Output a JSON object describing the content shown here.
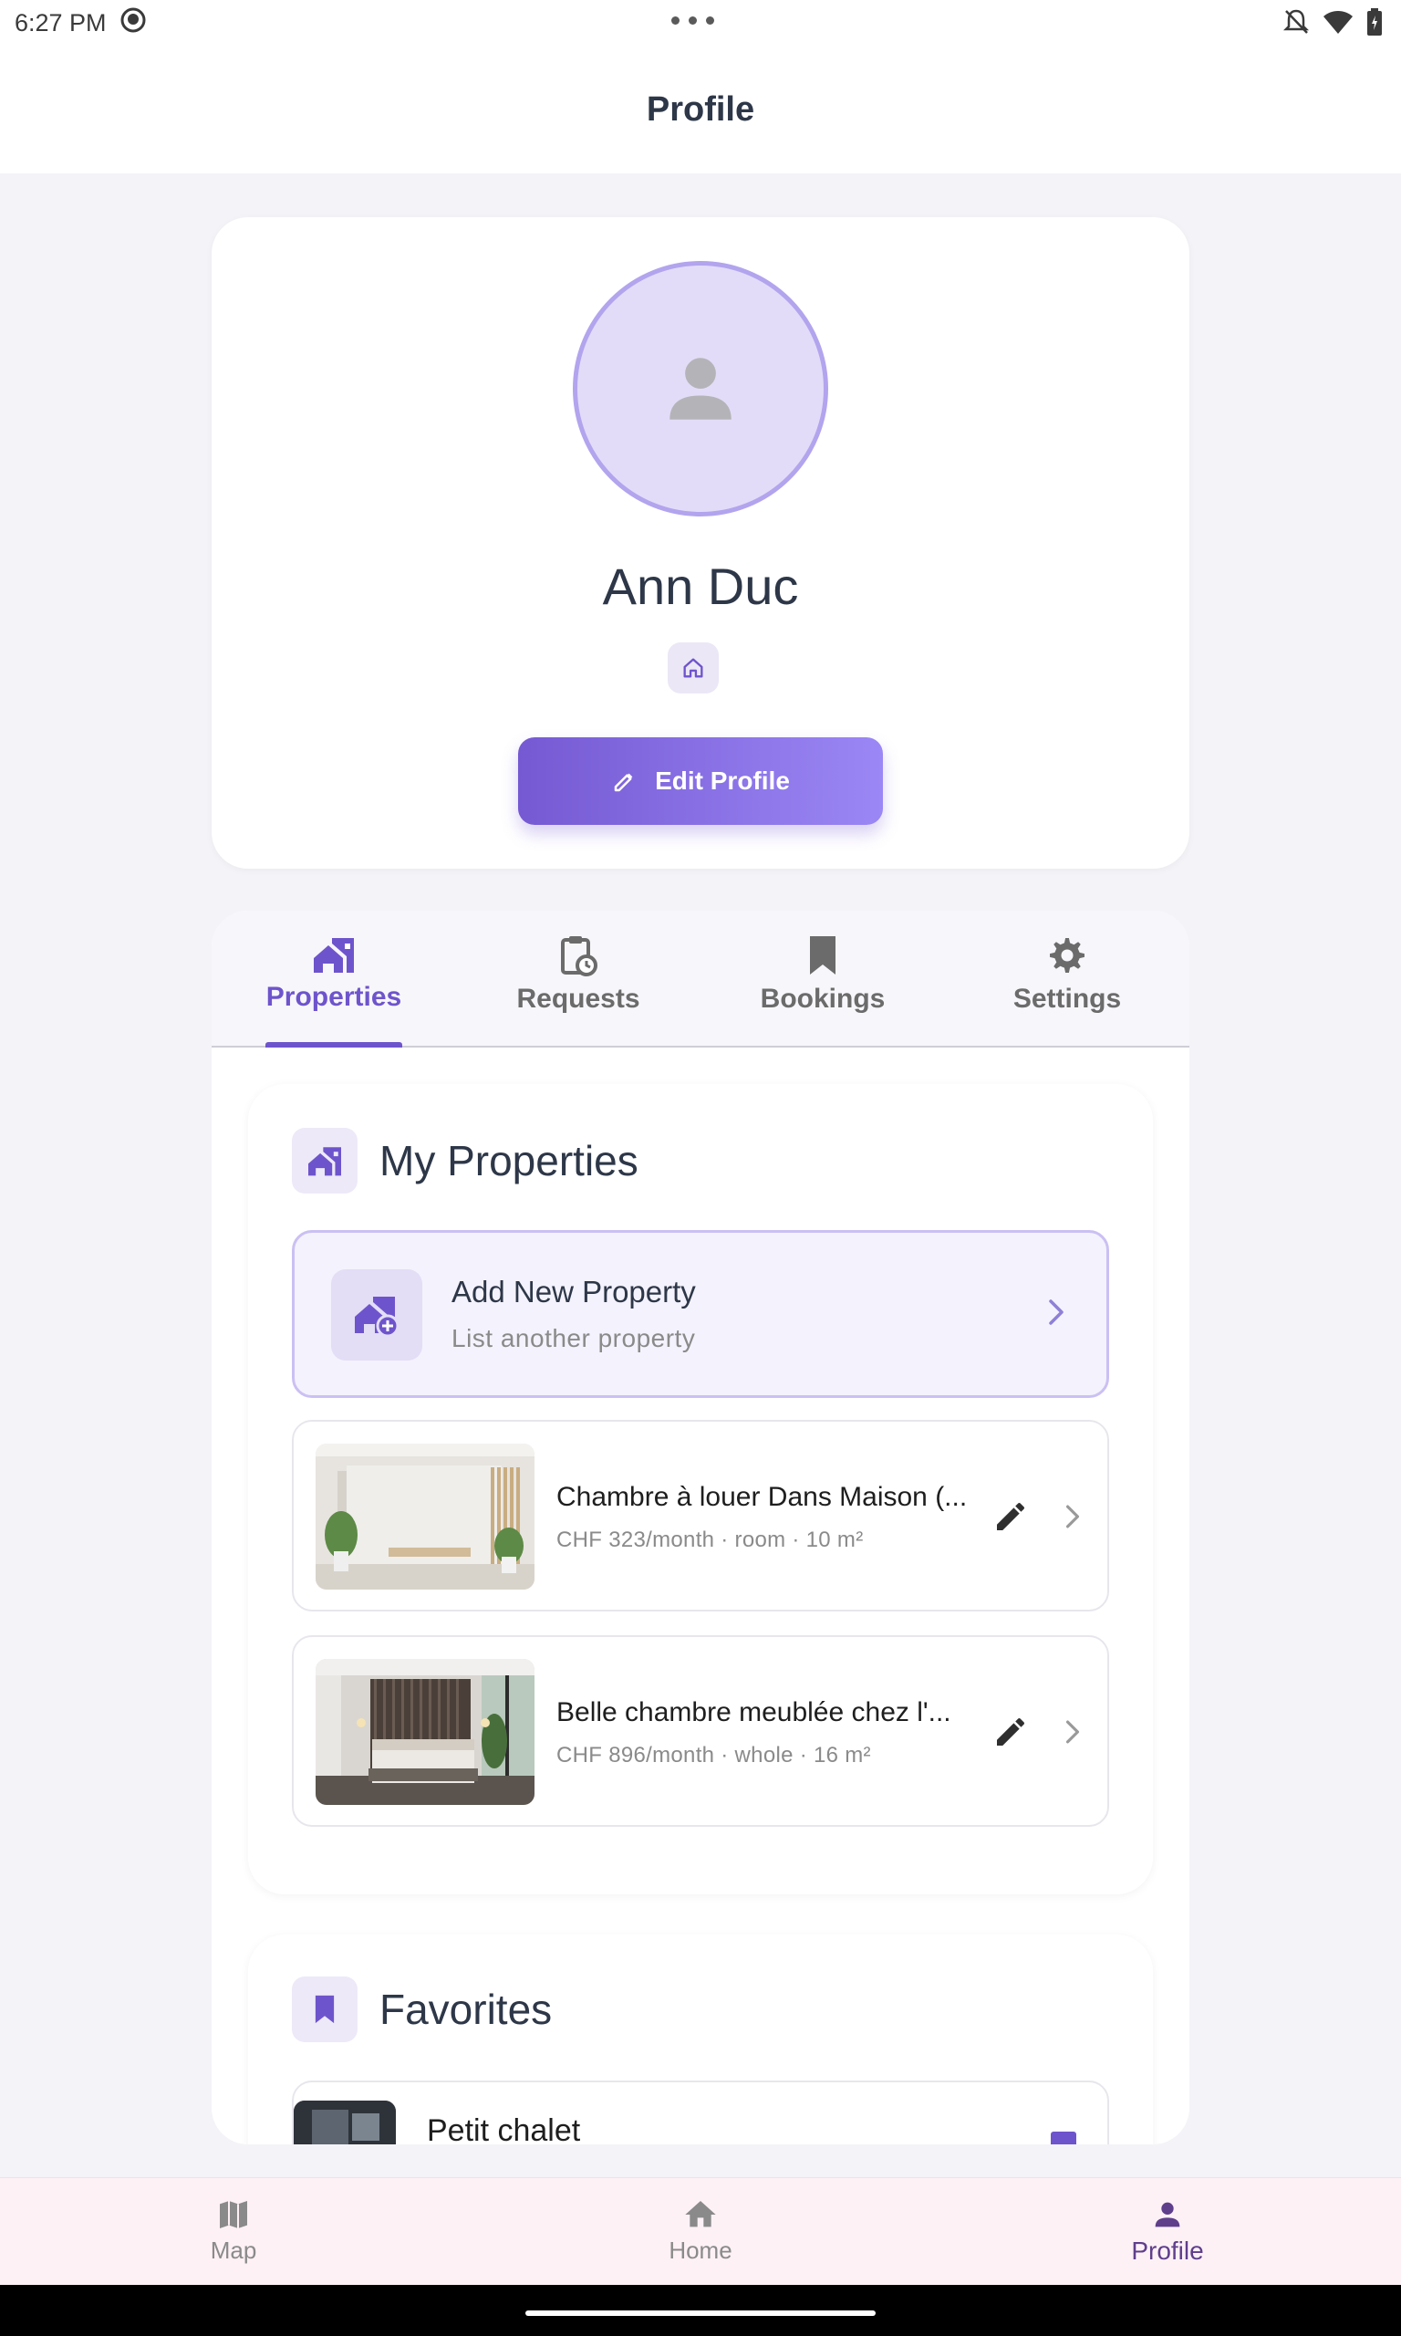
{
  "status_bar": {
    "time": "6:27 PM"
  },
  "app_bar": {
    "title": "Profile"
  },
  "profile": {
    "name": "Ann Duc",
    "edit_label": "Edit Profile"
  },
  "tabs": [
    {
      "label": "Properties",
      "icon": "properties-icon",
      "active": true
    },
    {
      "label": "Requests",
      "icon": "clipboard-clock-icon",
      "active": false
    },
    {
      "label": "Bookings",
      "icon": "bookmark-icon",
      "active": false
    },
    {
      "label": "Settings",
      "icon": "gear-icon",
      "active": false
    }
  ],
  "my_properties": {
    "title": "My Properties",
    "add_card": {
      "title": "Add New Property",
      "subtitle": "List another property"
    },
    "items": [
      {
        "title": "Chambre à louer Dans Maison (...",
        "subtitle": "CHF 323/month · room · 10 m²"
      },
      {
        "title": "Belle chambre meublée chez l'...",
        "subtitle": "CHF 896/month · whole · 16 m²"
      }
    ]
  },
  "favorites": {
    "title": "Favorites",
    "items": [
      {
        "title": "Petit chalet"
      }
    ]
  },
  "bottom_nav": [
    {
      "label": "Map",
      "icon": "map-icon",
      "active": false
    },
    {
      "label": "Home",
      "icon": "home-icon",
      "active": false
    },
    {
      "label": "Profile",
      "icon": "person-icon",
      "active": true
    }
  ],
  "colors": {
    "accent": "#6e54cc",
    "accent_light": "#9b87f5",
    "nav_active": "#5f3e8c"
  }
}
